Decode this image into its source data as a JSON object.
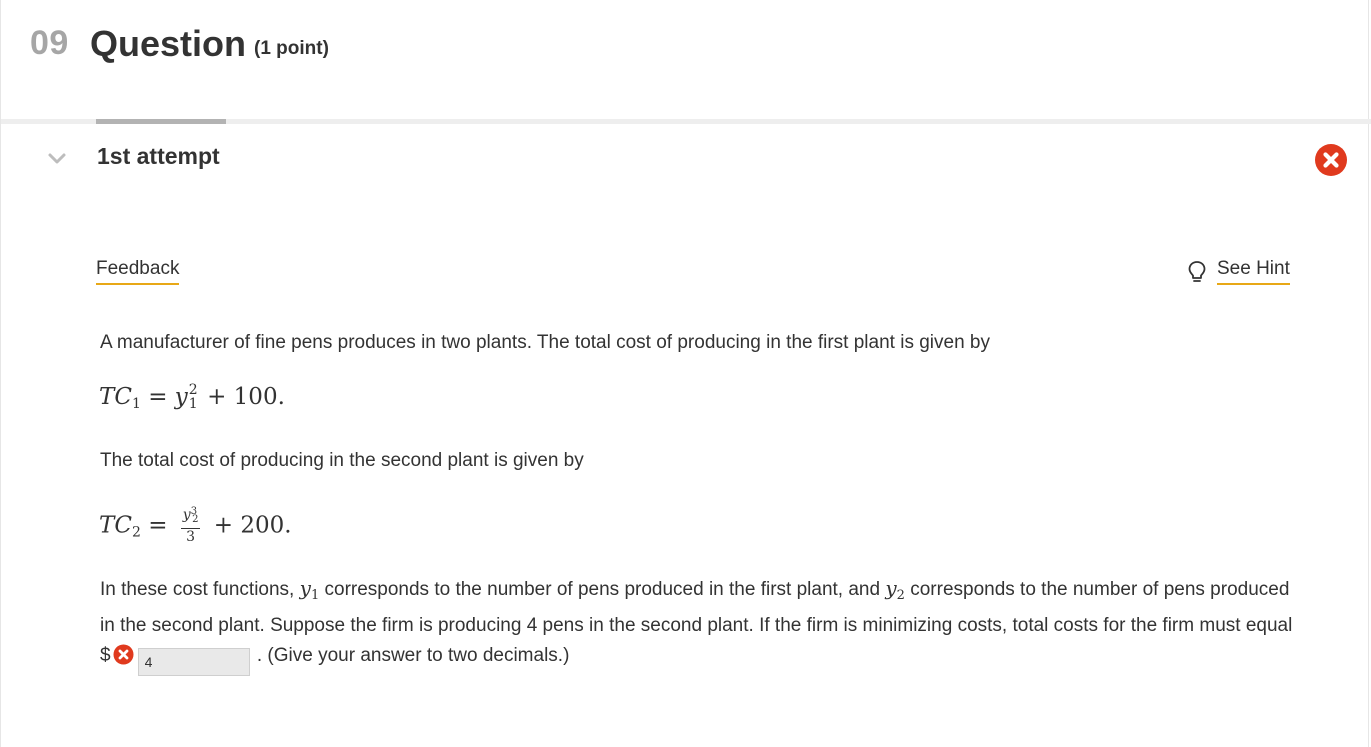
{
  "question": {
    "number": "09",
    "title": "Question",
    "points": "(1 point)"
  },
  "attempt": {
    "title": "1st attempt",
    "status": "incorrect"
  },
  "links": {
    "feedback": "Feedback",
    "hint": "See Hint"
  },
  "problem": {
    "intro": "A manufacturer of fine pens produces in two plants. The total cost of producing in the first plant is given by",
    "eq1": {
      "lhs": "TC",
      "lhs_sub": "1",
      "var": "y",
      "var_sub": "1",
      "var_sup": "2",
      "rest": "+ 100."
    },
    "second_plant": "The total cost of producing in the second plant is given by",
    "eq2": {
      "lhs": "TC",
      "lhs_sub": "2",
      "num_var": "y",
      "num_sub": "2",
      "num_sup": "3",
      "den": "3",
      "rest": "+ 200."
    },
    "text_a": "In these cost functions, ",
    "y1_var": "y",
    "y1_sub": "1",
    "text_b": " corresponds to the number of pens produced in the first plant, and ",
    "y2_var": "y",
    "y2_sub": "2",
    "text_c": " corresponds to the number of pens produced in the second plant. Suppose the firm is producing 4 pens in the second plant. If the firm is minimizing costs, total costs for the firm must equal $",
    "answer_value": "4",
    "text_d": " . (Give your answer to two decimals.)"
  },
  "colors": {
    "error_red": "#e03a1e",
    "link_underline": "#e8a817",
    "qnum_gray": "#a6a6a6"
  },
  "icons": {
    "chevron": "chevron-down-icon",
    "status": "incorrect-x-icon",
    "hint": "lightbulb-icon"
  }
}
